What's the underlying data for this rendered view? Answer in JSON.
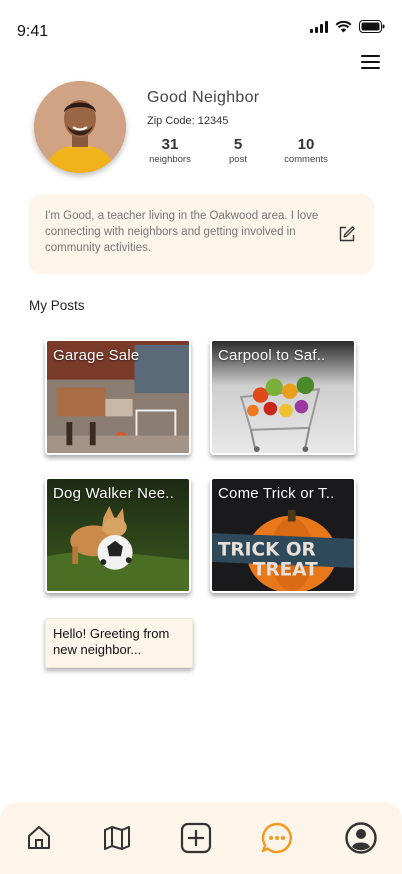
{
  "status_bar": {
    "time": "9:41"
  },
  "profile": {
    "name": "Good Neighbor",
    "zip_code": "Zip Code: 12345",
    "stats": {
      "neighbors": {
        "value": "31",
        "label": "neighbors"
      },
      "post": {
        "value": "5",
        "label": "post"
      },
      "comments": {
        "value": "10",
        "label": "comments"
      }
    },
    "bio": "I'm Good, a teacher living in the Oakwood area. I love connecting with neighbors and getting involved in community activities."
  },
  "posts_section": {
    "title": "My Posts"
  },
  "posts": [
    {
      "title": "Garage Sale"
    },
    {
      "title": "Carpool to Saf.."
    },
    {
      "title": "Dog Walker Nee.."
    },
    {
      "title": "Come Trick or T.."
    }
  ],
  "note": {
    "text": "Hello! Greeting from new neighbor..."
  },
  "trick_sign": {
    "line1": "TRICK OR",
    "line2": "TREAT"
  },
  "bottom_nav": {
    "items": [
      "home-icon",
      "map-icon",
      "add-post-icon",
      "chat-icon",
      "profile-icon"
    ],
    "active": "chat-icon",
    "active_color": "#f39a1e",
    "icon_color": "#333333"
  }
}
